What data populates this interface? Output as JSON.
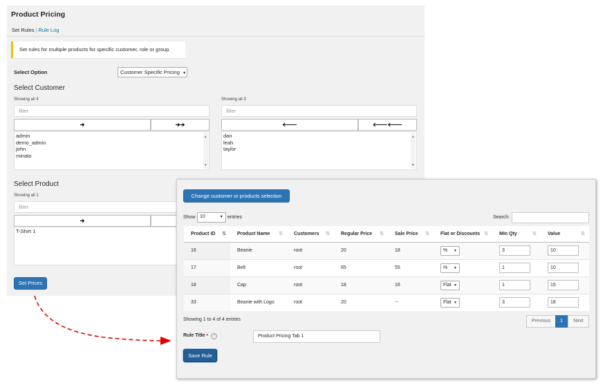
{
  "page_title": "Product Pricing",
  "tabs": [
    {
      "label": "Set Rules"
    },
    {
      "label": "Rule Log"
    }
  ],
  "notice": "Set rules for multiple products for specific customer, role or group.",
  "select_option": {
    "label": "Select Option",
    "value": "Customer Specific Pricing"
  },
  "customer": {
    "heading": "Select Customer",
    "left": {
      "showing": "Showing all 4",
      "filter_placeholder": "filter",
      "move_one": "➔",
      "move_all": "➔➔",
      "items": [
        "admin",
        "demo_admin",
        "john",
        "minato"
      ]
    },
    "right": {
      "showing": "Showing all 3",
      "filter_placeholder": "filter",
      "remove_one": "🡐",
      "remove_all": "🡐🡐",
      "items": [
        "dan",
        "leah",
        "taylor"
      ]
    }
  },
  "product": {
    "heading": "Select Product",
    "showing": "Showing all 1",
    "filter_placeholder": "filter",
    "move_one": "➔",
    "items": [
      "T-Shirt 1"
    ]
  },
  "set_prices_label": "Set Prices",
  "overlay": {
    "change_button": "Change customer or products selection",
    "show_label": "Show",
    "entries_value": "10",
    "entries_label": "entries",
    "search_label": "Search:",
    "columns": [
      "Product ID",
      "Product Name",
      "Customers",
      "Regular Price",
      "Sale Price",
      "Flat or Discounts",
      "Min Qty",
      "Value"
    ],
    "rows": [
      {
        "id": "16",
        "name": "Beanie",
        "customer": "root",
        "regular": "20",
        "sale": "18",
        "type": "%",
        "min_qty": "3",
        "value": "10"
      },
      {
        "id": "17",
        "name": "Belt",
        "customer": "root",
        "regular": "65",
        "sale": "55",
        "type": "%",
        "min_qty": "1",
        "value": "10"
      },
      {
        "id": "18",
        "name": "Cap",
        "customer": "root",
        "regular": "18",
        "sale": "16",
        "type": "Flat",
        "min_qty": "1",
        "value": "15"
      },
      {
        "id": "33",
        "name": "Beanie with Logo",
        "customer": "root",
        "regular": "20",
        "sale": "--",
        "type": "Flat",
        "min_qty": "3",
        "value": "18"
      }
    ],
    "info": "Showing 1 to 4 of 4 entries",
    "pagination": {
      "previous": "Previous",
      "current": "1",
      "next": "Next"
    },
    "rule_title_label": "Rule Title",
    "required_mark": "•",
    "help_icon": "?",
    "rule_title_value": "Product Pricing Tab 1",
    "save_label": "Save Rule"
  },
  "colors": {
    "primary_button": "#2e74b5",
    "notice_accent": "#ffb900",
    "link": "#0073aa",
    "arrow": "#e00000"
  }
}
